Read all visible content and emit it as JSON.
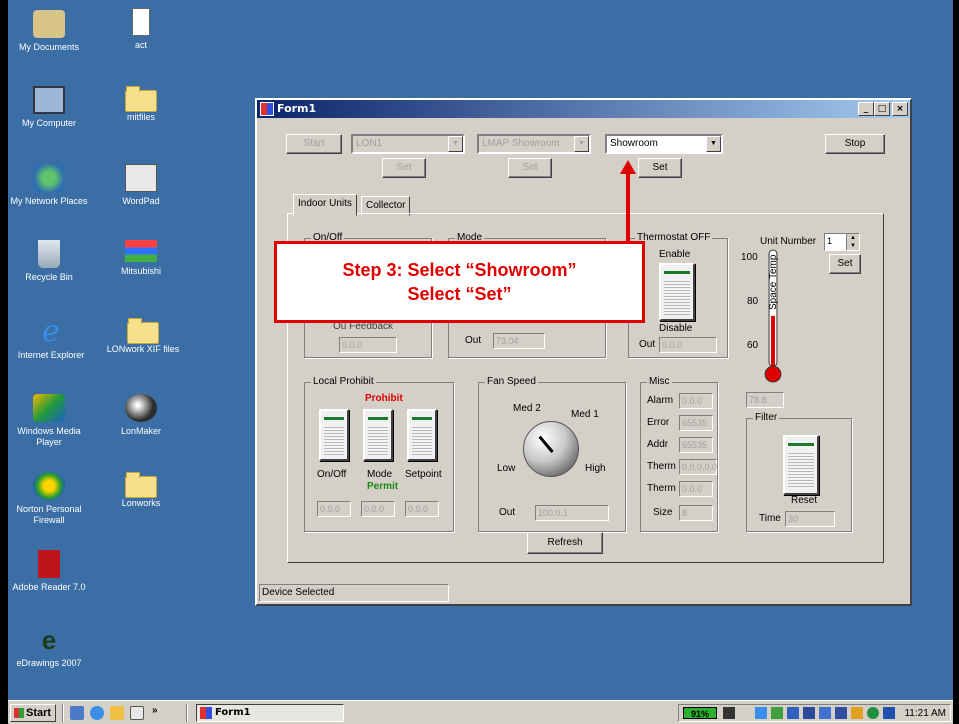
{
  "desktop": {
    "icons": [
      {
        "label": "My Documents",
        "icon": "my-documents-icon"
      },
      {
        "label": "act",
        "icon": "document-icon"
      },
      {
        "label": "My Computer",
        "icon": "computer-icon"
      },
      {
        "label": "mitfiles",
        "icon": "folder-icon"
      },
      {
        "label": "My Network Places",
        "icon": "network-icon"
      },
      {
        "label": "WordPad",
        "icon": "wordpad-icon"
      },
      {
        "label": "Recycle Bin",
        "icon": "recycle-bin-icon"
      },
      {
        "label": "Mitsubishi",
        "icon": "mitsubishi-icon"
      },
      {
        "label": "Internet Explorer",
        "icon": "internet-explorer-icon"
      },
      {
        "label": "LONwork XIF files",
        "icon": "folder-icon"
      },
      {
        "label": "Windows Media Player",
        "icon": "media-player-icon"
      },
      {
        "label": "LonMaker",
        "icon": "lonmaker-icon"
      },
      {
        "label": "Norton Personal Firewall",
        "icon": "norton-icon"
      },
      {
        "label": "Lonworks",
        "icon": "folder-icon"
      },
      {
        "label": "Adobe Reader 7.0",
        "icon": "adobe-reader-icon"
      },
      {
        "label": "eDrawings 2007",
        "icon": "edrawings-icon"
      }
    ]
  },
  "window": {
    "title": "Form1",
    "controls": [
      "_",
      "□",
      "×"
    ],
    "toolbar": {
      "start_label": "Start",
      "lon_value": "LON1",
      "lmap_value": "LMAP Showroom",
      "showroom_value": "Showroom",
      "set_label": "Set",
      "stop_label": "Stop"
    },
    "tabs": [
      "Indoor Units",
      "Collector"
    ],
    "onoff": {
      "title": "On/Off",
      "out_value": "0.0.0",
      "partial": "Ou        Feedback"
    },
    "mode": {
      "title": "Mode",
      "out_label": "Out",
      "out_value": "73.04"
    },
    "thermostat": {
      "title": "Thermostat OFF",
      "enable": "Enable",
      "disable": "Disable",
      "out_label": "Out",
      "out_value": "0.0.0"
    },
    "unit": {
      "label": "Unit Number",
      "value": "1",
      "set_label": "Set"
    },
    "thermometer": {
      "ticks": [
        "100",
        "80",
        "60"
      ],
      "axis_label": "Space Temp",
      "value": "78.8",
      "level_fraction": 0.45
    },
    "local_prohibit": {
      "title": "Local Prohibit",
      "prohibit": "Prohibit",
      "permit": "Permit",
      "switch_labels": [
        "On/Off",
        "Mode",
        "Setpoint"
      ],
      "values": [
        "0.0.0",
        "0.0.0",
        "0.0.0"
      ]
    },
    "fan_speed": {
      "title": "Fan Speed",
      "labels": [
        "Med 2",
        "Med 1",
        "Low",
        "High"
      ],
      "out_label": "Out",
      "out_value": "100.0.1"
    },
    "misc": {
      "title": "Misc",
      "rows": [
        {
          "label": "Alarm",
          "value": "0.0.0"
        },
        {
          "label": "Error",
          "value": "65535"
        },
        {
          "label": "Addr",
          "value": "65535"
        },
        {
          "label": "Therm",
          "value": "0,0,0,0,0"
        },
        {
          "label": "Therm",
          "value": "0.0.0"
        },
        {
          "label": "Size",
          "value": "8"
        }
      ]
    },
    "filter": {
      "title": "Filter",
      "reset": "Reset",
      "time_label": "Time",
      "time_value": "30"
    },
    "refresh_label": "Refresh",
    "status": "Device Selected"
  },
  "annotation": {
    "line1": "Step 3: Select “Showroom”",
    "line2": "Select “Set”",
    "color": "#e00000"
  },
  "taskbar": {
    "start_label": "Start",
    "chevron": "»",
    "task": "Form1",
    "battery": "91%",
    "clock": "11:21 AM"
  }
}
